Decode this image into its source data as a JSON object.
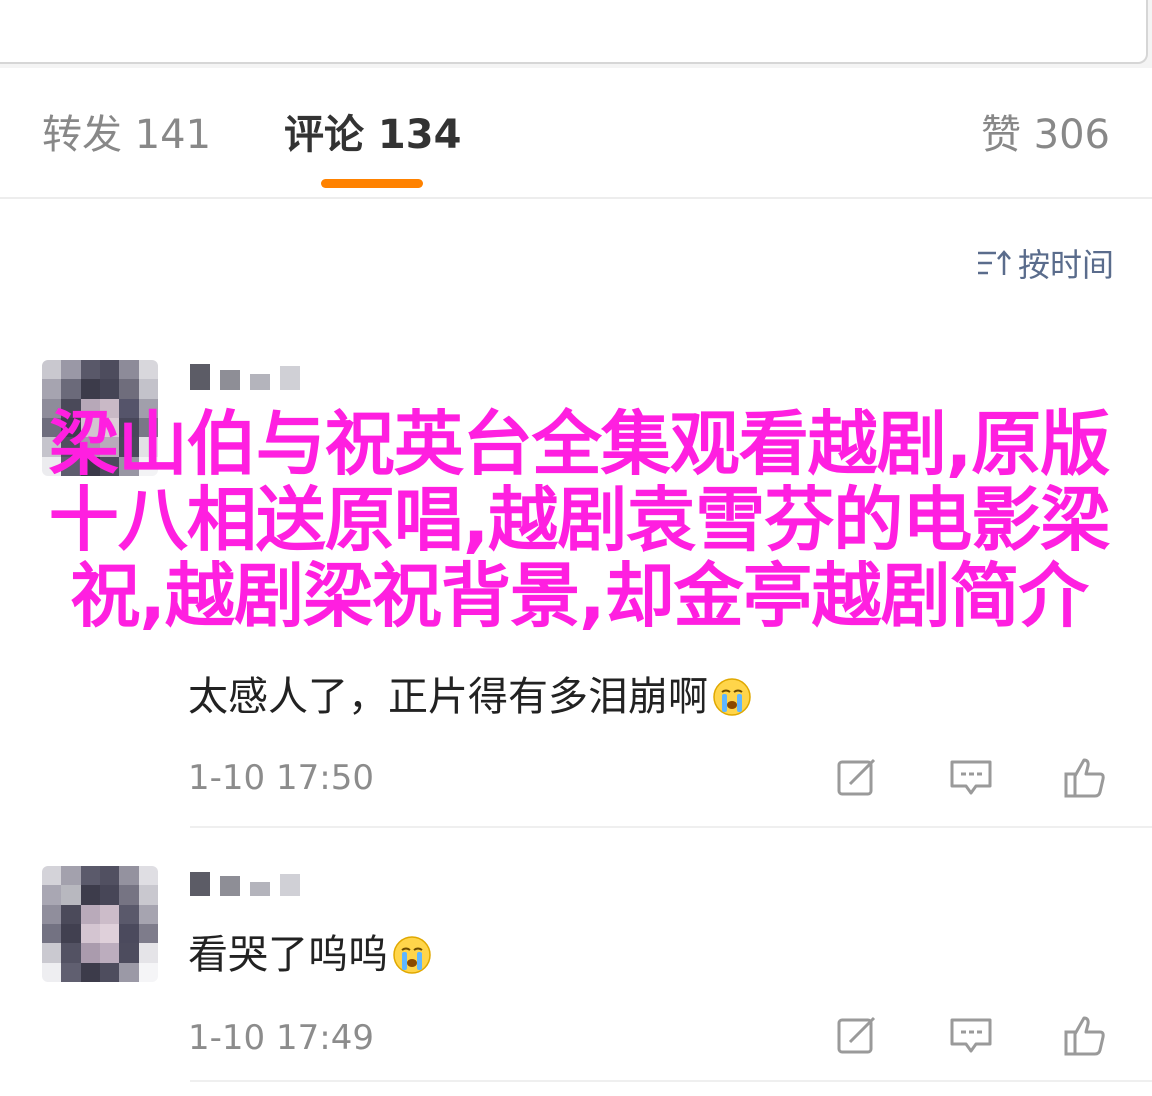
{
  "tabs": {
    "repost_label": "转发 141",
    "comment_label": "评论 134",
    "like_label": "赞 306"
  },
  "sort": {
    "label": "按时间",
    "icon": "sort-icon"
  },
  "comments": [
    {
      "text": "太感人了，正片得有多泪崩啊",
      "emoji": "crying-face",
      "time": "1-10 17:50"
    },
    {
      "text": "看哭了呜呜",
      "emoji": "crying-face",
      "time": "1-10 17:49"
    }
  ],
  "overlay": {
    "title": "梁山伯与祝英台全集观看越剧,原版十八相送原唱,越剧袁雪芬的电影梁祝,越剧梁祝背景,却金亭越剧简介"
  },
  "colors": {
    "accent": "#ff8200",
    "overlay_text": "#ff1fe0",
    "sort_text": "#5a6c8c",
    "muted_text": "#888888"
  },
  "icons": [
    "sort-icon",
    "edit-icon",
    "reply-icon",
    "like-icon",
    "crying-face-emoji"
  ]
}
